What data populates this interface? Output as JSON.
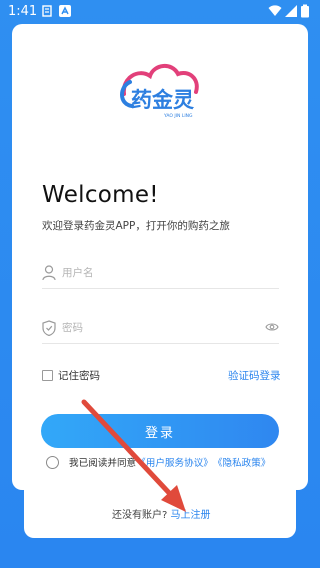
{
  "status_bar": {
    "time": "1:41"
  },
  "brand": {
    "name": "药金灵",
    "subtitle": "YAO JIN LING"
  },
  "welcome": {
    "title": "Welcome!",
    "subtitle": "欢迎登录药金灵APP，打开你的购药之旅"
  },
  "form": {
    "username": {
      "placeholder": "用户名",
      "value": ""
    },
    "password": {
      "placeholder": "密码",
      "value": ""
    },
    "remember_label": "记住密码",
    "code_login_label": "验证码登录",
    "login_button": "登录"
  },
  "agreement": {
    "prefix": "我已阅读并同意",
    "user_agreement": "《用户服务协议》",
    "privacy_policy": "《隐私政策》"
  },
  "signup": {
    "question": "还没有账户?",
    "link": "马上注册"
  },
  "colors": {
    "accent": "#2b85ee",
    "background": "#2f8ff1",
    "annotation_arrow": "#e04a3b",
    "logo_arc": "#e2407a"
  }
}
